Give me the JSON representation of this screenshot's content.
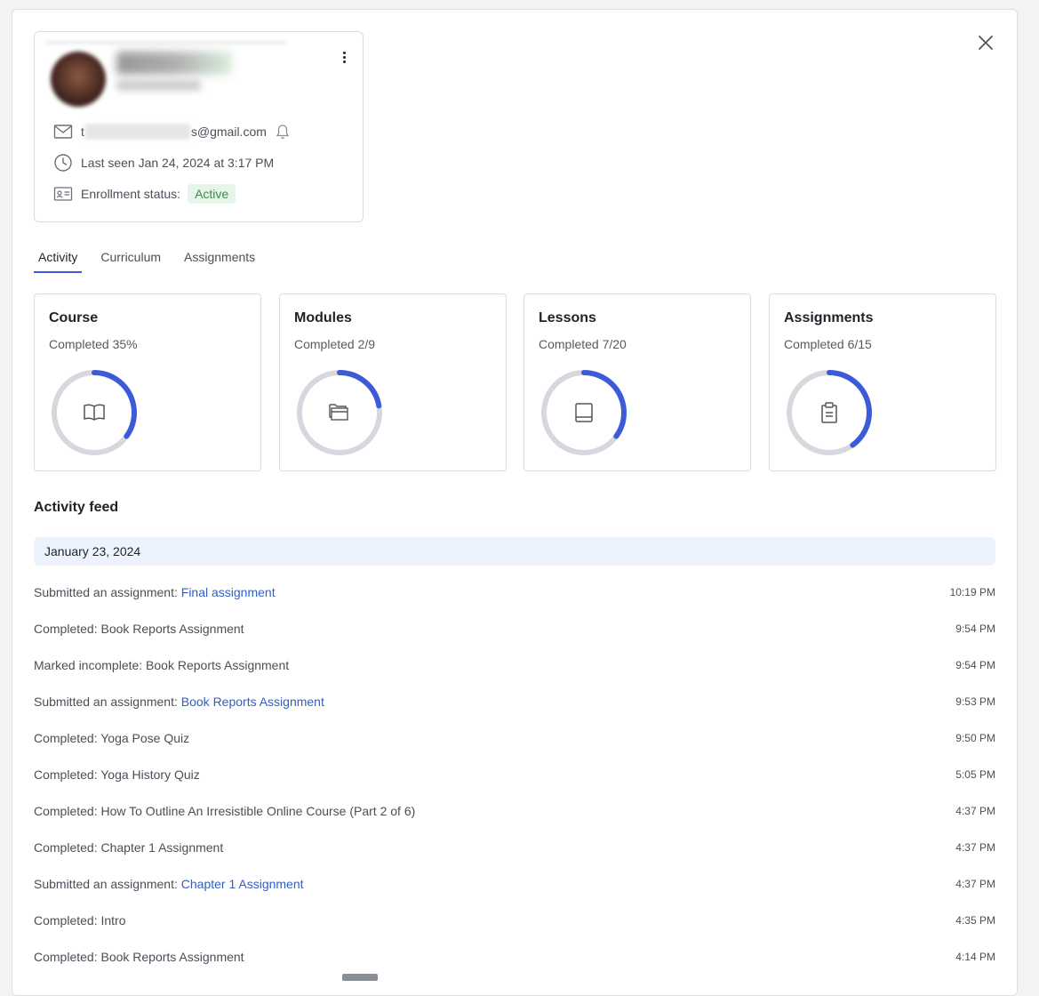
{
  "profile": {
    "email_prefix": "t",
    "email_suffix": "s@gmail.com",
    "last_seen": "Last seen Jan 24, 2024 at 3:17 PM",
    "enrollment_label": "Enrollment status:",
    "enrollment_status": "Active"
  },
  "tabs": [
    {
      "label": "Activity",
      "active": true
    },
    {
      "label": "Curriculum",
      "active": false
    },
    {
      "label": "Assignments",
      "active": false
    }
  ],
  "stats": [
    {
      "title": "Course",
      "subtitle": "Completed 35%",
      "progress": 0.35,
      "icon": "book-open-icon"
    },
    {
      "title": "Modules",
      "subtitle": "Completed 2/9",
      "progress": 0.2222,
      "icon": "folders-icon"
    },
    {
      "title": "Lessons",
      "subtitle": "Completed 7/20",
      "progress": 0.35,
      "icon": "book-icon"
    },
    {
      "title": "Assignments",
      "subtitle": "Completed 6/15",
      "progress": 0.4,
      "icon": "clipboard-icon"
    }
  ],
  "colors": {
    "accent": "#3d5bd9",
    "ring_track": "#d6d8dd",
    "link": "#2f5fc4",
    "badge_bg": "#e6f5e9",
    "badge_text": "#3d8a4f"
  },
  "feed": {
    "title": "Activity feed",
    "date": "January 23, 2024",
    "items": [
      {
        "prefix": "Submitted an assignment: ",
        "link": "Final assignment",
        "time": "10:19 PM"
      },
      {
        "prefix": "Completed: Book Reports Assignment",
        "link": "",
        "time": "9:54 PM"
      },
      {
        "prefix": "Marked incomplete: Book Reports Assignment",
        "link": "",
        "time": "9:54 PM"
      },
      {
        "prefix": "Submitted an assignment: ",
        "link": "Book Reports Assignment",
        "time": "9:53 PM"
      },
      {
        "prefix": "Completed: Yoga Pose Quiz",
        "link": "",
        "time": "9:50 PM"
      },
      {
        "prefix": "Completed: Yoga History Quiz",
        "link": "",
        "time": "5:05 PM"
      },
      {
        "prefix": "Completed: How To Outline An Irresistible Online Course (Part 2 of 6)",
        "link": "",
        "time": "4:37 PM"
      },
      {
        "prefix": "Completed: Chapter 1 Assignment",
        "link": "",
        "time": "4:37 PM"
      },
      {
        "prefix": "Submitted an assignment: ",
        "link": "Chapter 1 Assignment",
        "time": "4:37 PM"
      },
      {
        "prefix": "Completed: Intro",
        "link": "",
        "time": "4:35 PM"
      },
      {
        "prefix": "Completed: Book Reports Assignment",
        "link": "",
        "time": "4:14 PM"
      }
    ]
  }
}
